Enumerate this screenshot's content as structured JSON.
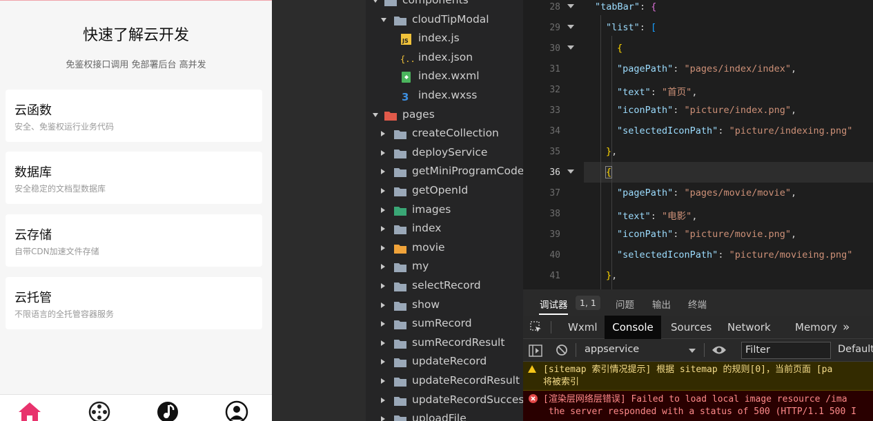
{
  "simulator": {
    "title": "快速了解云开发",
    "subtitle": "免鉴权接口调用 免部署后台 高并发",
    "cards": [
      {
        "title": "云函数",
        "desc": "安全、免鉴权运行业务代码"
      },
      {
        "title": "数据库",
        "desc": "安全稳定的文档型数据库"
      },
      {
        "title": "云存储",
        "desc": "自带CDN加速文件存储"
      },
      {
        "title": "云托管",
        "desc": "不限语言的全托管容器服务"
      }
    ],
    "tabbar": [
      "home-icon",
      "movie-icon",
      "music-icon",
      "user-icon"
    ],
    "accent": "#e8336d"
  },
  "file_tree": {
    "rows": [
      {
        "label": "components",
        "type": "folder",
        "expanded": true
      },
      {
        "label": "cloudTipModal",
        "type": "folder-open",
        "expanded": true
      },
      {
        "label": "index.js",
        "type": "js"
      },
      {
        "label": "index.json",
        "type": "json"
      },
      {
        "label": "index.wxml",
        "type": "wxml"
      },
      {
        "label": "index.wxss",
        "type": "wxss"
      },
      {
        "label": "pages",
        "type": "folder-red",
        "expanded": true
      },
      {
        "label": "createCollection",
        "type": "folder"
      },
      {
        "label": "deployService",
        "type": "folder"
      },
      {
        "label": "getMiniProgramCode",
        "type": "folder"
      },
      {
        "label": "getOpenId",
        "type": "folder"
      },
      {
        "label": "images",
        "type": "folder-green"
      },
      {
        "label": "index",
        "type": "folder"
      },
      {
        "label": "movie",
        "type": "folder-orange"
      },
      {
        "label": "my",
        "type": "folder"
      },
      {
        "label": "selectRecord",
        "type": "folder"
      },
      {
        "label": "show",
        "type": "folder"
      },
      {
        "label": "sumRecord",
        "type": "folder"
      },
      {
        "label": "sumRecordResult",
        "type": "folder"
      },
      {
        "label": "updateRecord",
        "type": "folder"
      },
      {
        "label": "updateRecordResult",
        "type": "folder"
      },
      {
        "label": "updateRecordSuccess",
        "type": "folder"
      },
      {
        "label": "uploadFile",
        "type": "folder"
      }
    ]
  },
  "editor": {
    "line_numbers": [
      "28",
      "29",
      "30",
      "31",
      "32",
      "33",
      "34",
      "35",
      "36",
      "37",
      "38",
      "39",
      "40",
      "41"
    ],
    "code": {
      "l28_key": "\"tabBar\"",
      "l28_rest": ": {",
      "l29_key": "\"list\"",
      "l29_rest": ": [",
      "l30": "{",
      "l31_key": "\"pagePath\"",
      "l31_val": "\"pages/index/index\"",
      "l32_key": "\"text\"",
      "l32_val": "\"首页\"",
      "l33_key": "\"iconPath\"",
      "l33_val": "\"picture/index.png\"",
      "l34_key": "\"selectedIconPath\"",
      "l34_val": "\"picture/indexing.png\"",
      "l35": "},",
      "l36": "{",
      "l37_key": "\"pagePath\"",
      "l37_val": "\"pages/movie/movie\"",
      "l38_key": "\"text\"",
      "l38_val": "\"电影\"",
      "l39_key": "\"iconPath\"",
      "l39_val": "\"picture/movie.png\"",
      "l40_key": "\"selectedIconPath\"",
      "l40_val": "\"picture/movieing.png\"",
      "l41": "},",
      "colon": ": ",
      "comma": ","
    }
  },
  "debugger": {
    "tabs": [
      "调试器",
      "问题",
      "输出",
      "终端"
    ],
    "badge": "1, 1",
    "panel_tabs": [
      "Wxml",
      "Console",
      "Sources",
      "Network",
      "Memory"
    ],
    "more": "»",
    "context": "appservice",
    "filter_placeholder": "Filter",
    "levels": "Default",
    "warning_line1": "[sitemap 索引情况提示] 根据 sitemap 的规则[0]，当前页面 [pa",
    "warning_line2": "将被索引",
    "error_line1": "[渲染层网络层错误] Failed to load local image resource /ima",
    "error_line2": " the server responded with a status of 500 (HTTP/1.1 500 I"
  }
}
